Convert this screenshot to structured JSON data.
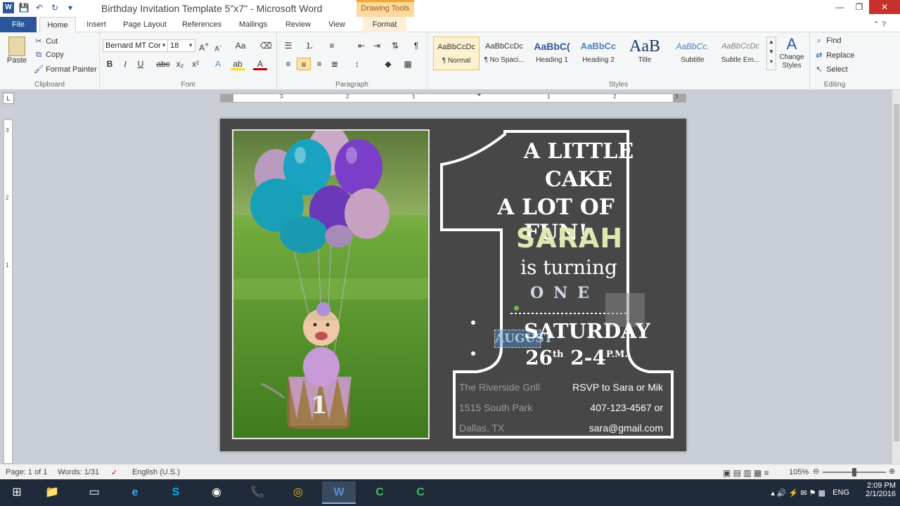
{
  "window": {
    "title": "Birthday Invitation Template 5\"x7\"  -  Microsoft Word",
    "context_tab_group": "Drawing Tools",
    "minimize": "—",
    "restore": "❐",
    "close": "✕"
  },
  "qat": {
    "app_icon": "W",
    "save": "💾",
    "undo": "↶",
    "redo": "↻",
    "more": "▾"
  },
  "tabs": [
    {
      "label": "File"
    },
    {
      "label": "Home"
    },
    {
      "label": "Insert"
    },
    {
      "label": "Page Layout"
    },
    {
      "label": "References"
    },
    {
      "label": "Mailings"
    },
    {
      "label": "Review"
    },
    {
      "label": "View"
    },
    {
      "label": "Format"
    }
  ],
  "clipboard": {
    "paste": "Paste",
    "cut": "Cut",
    "copy": "Copy",
    "format_painter": "Format Painter",
    "label": "Clipboard"
  },
  "font": {
    "name": "Bernard MT Cor",
    "size": "18",
    "label": "Font"
  },
  "paragraph": {
    "label": "Paragraph"
  },
  "styles": {
    "label": "Styles",
    "items": [
      {
        "preview": "AaBbCcDc",
        "name": "¶ Normal"
      },
      {
        "preview": "AaBbCcDc",
        "name": "¶ No Spaci..."
      },
      {
        "preview": "AaBbC(",
        "name": "Heading 1"
      },
      {
        "preview": "AaBbCc",
        "name": "Heading 2"
      },
      {
        "preview": "AaB",
        "name": "Title"
      },
      {
        "preview": "AaBbCc.",
        "name": "Subtitle"
      },
      {
        "preview": "AaBbCcDc",
        "name": "Subtle Em..."
      }
    ],
    "change_styles": "Change Styles"
  },
  "editing": {
    "find": "Find",
    "replace": "Replace",
    "select": "Select",
    "label": "Editing"
  },
  "ruler": {
    "h_numbers": [
      "3",
      "2",
      "1",
      "1",
      "2",
      "3"
    ],
    "v_numbers": [
      "3",
      "2",
      "1"
    ]
  },
  "invitation": {
    "line1": "A LITTLE",
    "line2": "CAKE",
    "line3": "A LOT OF FUN!",
    "name": "SARAH",
    "turning": "is turning",
    "age": "ONE",
    "month": "AUGUST",
    "day": "SATURDAY",
    "date": "26",
    "date_suffix": "th",
    "time": "2-4",
    "time_suffix": "P.M.",
    "photo_number": "1",
    "venue": [
      "The Riverside Grill",
      "1515 South Park",
      "Dallas, TX"
    ],
    "rsvp": [
      "RSVP to Sara or Mik",
      "407-123-4567 or",
      "sara@gmail.com"
    ]
  },
  "status": {
    "page": "Page: 1 of 1",
    "words": "Words: 1/31",
    "language": "English (U.S.)",
    "zoom": "105%",
    "zoom_fraction": 0.5
  },
  "taskbar": {
    "apps": [
      "⊞",
      "📁",
      "▭",
      "e",
      "S",
      "◉",
      "📞",
      "◎",
      "W",
      "C",
      "C"
    ],
    "lang": "ENG",
    "time": "2:09 PM",
    "date": "2/1/2016"
  },
  "colors": {
    "word_blue": "#2b579a",
    "doc_bg": "#474747",
    "name_green": "#dfe8b0",
    "balloon_teal": "#1aa3c0",
    "balloon_purple": "#7a3ec8"
  }
}
